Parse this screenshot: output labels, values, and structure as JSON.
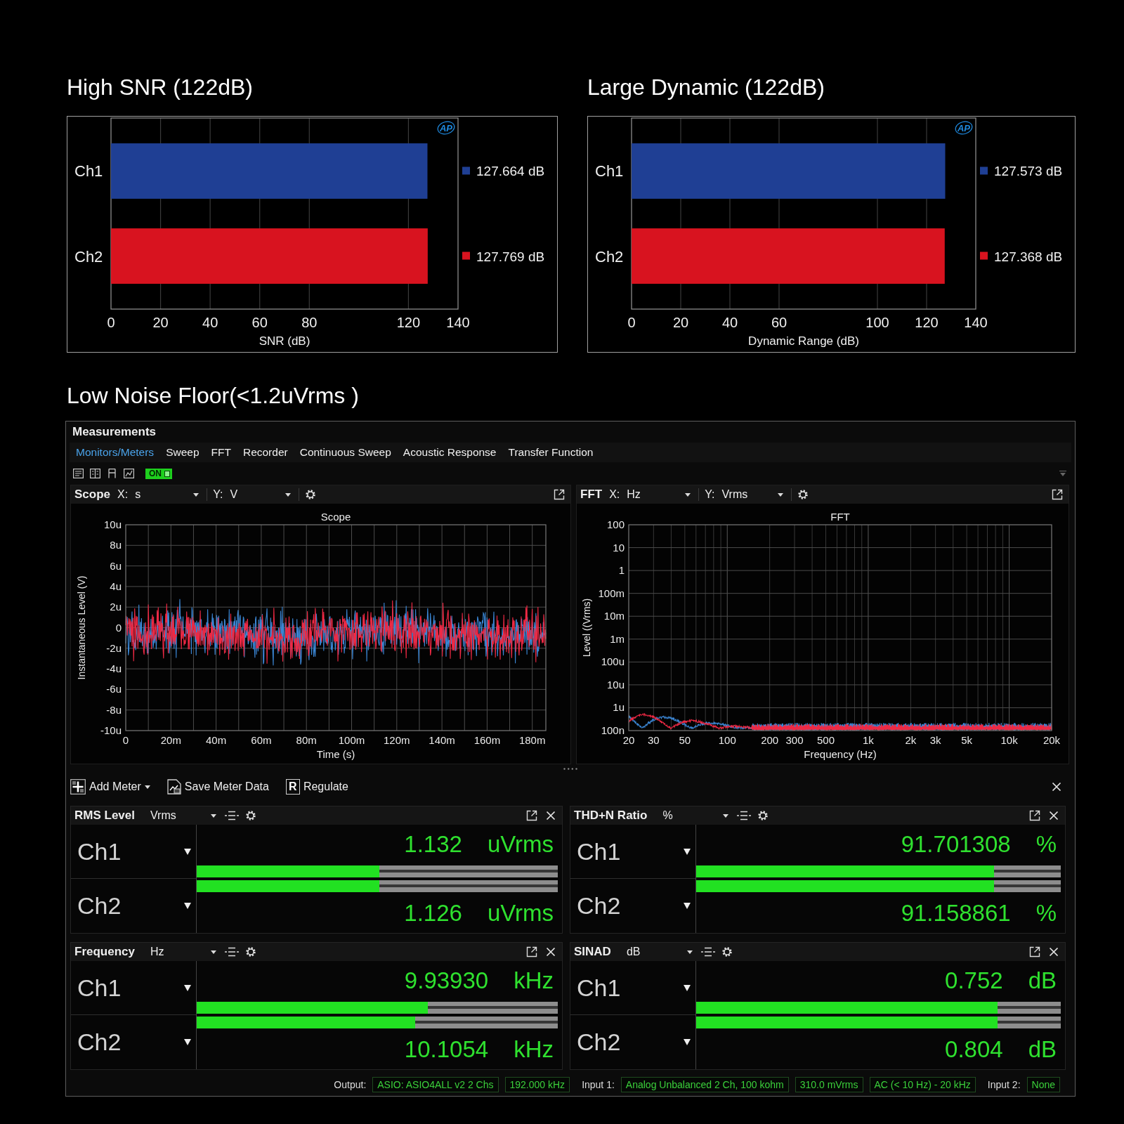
{
  "charts": [
    {
      "logo": "AP",
      "chart_data": {
        "type": "bar",
        "orientation": "horizontal",
        "title": "High SNR (122dB)",
        "xlabel": "SNR (dB)",
        "series": [
          {
            "name": "Ch1",
            "color": "#1f3f94",
            "values": [
              127.664
            ]
          },
          {
            "name": "Ch2",
            "color": "#d8131f",
            "values": [
              127.769
            ]
          }
        ],
        "xlim": [
          0,
          140
        ],
        "xticks": [
          0,
          20,
          40,
          60,
          80,
          120,
          140
        ],
        "grid": true,
        "value_labels": [
          "127.664 dB",
          "127.769 dB"
        ]
      }
    },
    {
      "logo": "AP",
      "chart_data": {
        "type": "bar",
        "orientation": "horizontal",
        "title": "Large Dynamic (122dB)",
        "xlabel": "Dynamic Range (dB)",
        "series": [
          {
            "name": "Ch1",
            "color": "#1f3f94",
            "values": [
              127.573
            ]
          },
          {
            "name": "Ch2",
            "color": "#d8131f",
            "values": [
              127.368
            ]
          }
        ],
        "xlim": [
          0,
          140
        ],
        "xticks": [
          0,
          20,
          40,
          60,
          100,
          120,
          140
        ],
        "grid": true,
        "value_labels": [
          "127.573 dB",
          "127.368 dB"
        ]
      }
    }
  ],
  "section_title": "Low Noise Floor(<1.2uVrms )",
  "measurements": {
    "title": "Measurements",
    "tabs": [
      {
        "label": "Monitors/Meters",
        "selected": true
      },
      {
        "label": "Sweep",
        "selected": false
      },
      {
        "label": "FFT",
        "selected": false
      },
      {
        "label": "Recorder",
        "selected": false
      },
      {
        "label": "Continuous Sweep",
        "selected": false
      },
      {
        "label": "Acoustic Response",
        "selected": false
      },
      {
        "label": "Transfer Function",
        "selected": false
      }
    ],
    "toggle": {
      "label": "ON",
      "on": true
    },
    "graphs": [
      {
        "kind": "scope",
        "name": "Scope",
        "x_select": {
          "label": "X:",
          "value": "s"
        },
        "y_select": {
          "label": "Y:",
          "value": "V"
        },
        "title": "Scope",
        "ylabel": "Instantaneous Level (V)",
        "xlabel": "Time (s)",
        "y_ticks": [
          "10u",
          "8u",
          "6u",
          "4u",
          "2u",
          "0",
          "-2u",
          "-4u",
          "-6u",
          "-8u",
          "-10u"
        ],
        "x_ticks": [
          "0",
          "20m",
          "40m",
          "60m",
          "80m",
          "100m",
          "120m",
          "140m",
          "160m",
          "180m"
        ],
        "traces": [
          {
            "color": "#3b86d4"
          },
          {
            "color": "#ee2944"
          }
        ]
      },
      {
        "kind": "fft",
        "name": "FFT",
        "x_select": {
          "label": "X:",
          "value": "Hz"
        },
        "y_select": {
          "label": "Y:",
          "value": "Vrms"
        },
        "title": "FFT",
        "ylabel": "Level ((Vrms)",
        "xlabel": "Frequency (Hz)",
        "y_ticks": [
          "100",
          "10",
          "1",
          "100m",
          "10m",
          "1m",
          "100u",
          "10u",
          "1u",
          "100n"
        ],
        "x_ticks": [
          "20",
          "30",
          "50",
          "100",
          "200",
          "300",
          "500",
          "1k",
          "2k",
          "3k",
          "5k",
          "10k",
          "20k"
        ],
        "traces": [
          {
            "color": "#3b86d4"
          },
          {
            "color": "#ee2944"
          }
        ]
      }
    ],
    "meter_buttons": [
      {
        "kind": "add",
        "label": "Add Meter"
      },
      {
        "kind": "save",
        "label": "Save Meter Data"
      },
      {
        "kind": "regulate",
        "icon": "R",
        "label": "Regulate"
      }
    ],
    "meters": [
      {
        "title": "RMS Level",
        "unit": "Vrms",
        "channels": [
          {
            "name": "Ch1",
            "value": "1.132",
            "unit": "uVrms",
            "level": 0.505
          },
          {
            "name": "Ch2",
            "value": "1.126",
            "unit": "uVrms",
            "level": 0.505
          }
        ]
      },
      {
        "title": "THD+N Ratio",
        "unit": "%",
        "channels": [
          {
            "name": "Ch1",
            "value": "91.701308",
            "unit": "%",
            "level": 0.816
          },
          {
            "name": "Ch2",
            "value": "91.158861",
            "unit": "%",
            "level": 0.816
          }
        ]
      },
      {
        "title": "Frequency",
        "unit": "Hz",
        "channels": [
          {
            "name": "Ch1",
            "value": "9.93930",
            "unit": "kHz",
            "level": 0.64
          },
          {
            "name": "Ch2",
            "value": "10.1054",
            "unit": "kHz",
            "level": 0.605
          }
        ]
      },
      {
        "title": "SINAD",
        "unit": "dB",
        "channels": [
          {
            "name": "Ch1",
            "value": "0.752",
            "unit": "dB",
            "level": 0.826
          },
          {
            "name": "Ch2",
            "value": "0.804",
            "unit": "dB",
            "level": 0.826
          }
        ]
      }
    ],
    "status_bar": [
      {
        "kind": "label",
        "text": "Output:"
      },
      {
        "kind": "value",
        "text": "ASIO: ASIO4ALL v2 2 Chs"
      },
      {
        "kind": "value",
        "text": "192.000 kHz"
      },
      {
        "kind": "label",
        "text": "Input 1:"
      },
      {
        "kind": "value",
        "text": "Analog Unbalanced 2 Ch, 100 kohm"
      },
      {
        "kind": "value",
        "text": "310.0 mVrms"
      },
      {
        "kind": "value",
        "text": "AC (< 10 Hz) - 20 kHz"
      },
      {
        "kind": "label",
        "text": "Input 2:"
      },
      {
        "kind": "value",
        "text": "None"
      }
    ]
  }
}
